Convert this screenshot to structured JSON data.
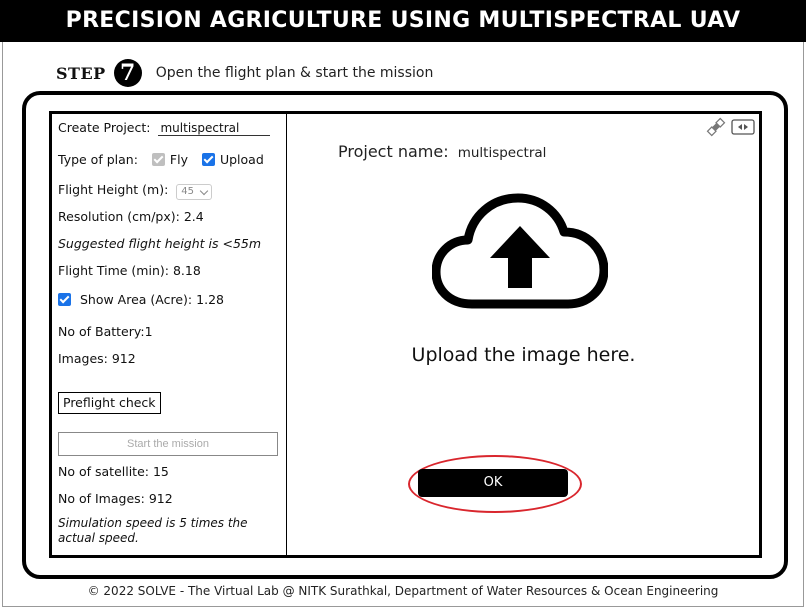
{
  "header": {
    "title": "PRECISION AGRICULTURE USING MULTISPECTRAL UAV"
  },
  "step": {
    "word": "STEP",
    "number": "7",
    "text": "Open the flight plan & start the mission"
  },
  "left": {
    "create_project_label": "Create Project:",
    "create_project_value": "multispectral",
    "type_of_plan_label": "Type of plan:",
    "fly_label": "Fly",
    "fly_checked": true,
    "fly_disabled": true,
    "upload_label": "Upload",
    "upload_checked": true,
    "flight_height_label": "Flight Height (m):",
    "flight_height_value": "45",
    "resolution_label": "Resolution (cm/px):",
    "resolution_value": "2.4",
    "suggested_text": "Suggested flight height is <55m",
    "flight_time_label": "Flight Time (min):",
    "flight_time_value": "8.18",
    "show_area_label": "Show Area (Acre):",
    "show_area_value": "1.28",
    "show_area_checked": true,
    "battery_label": "No of Battery:",
    "battery_value": "1",
    "images_label": "Images:",
    "images_value": "912",
    "preflight_button": "Preflight check",
    "start_mission_button": "Start the mission",
    "satellite_label": "No of satellite:",
    "satellite_value": "15",
    "no_images_label": "No of Images:",
    "no_images_value": "912",
    "simulation_text_line1": "Simulation speed is 5 times the",
    "simulation_text_line2": "actual speed."
  },
  "right": {
    "project_name_label": "Project name:",
    "project_name_value": "multispectral",
    "upload_text": "Upload the image here.",
    "ok_button": "OK",
    "icons": [
      "satellite-icon",
      "switch-panel-icon",
      "cloud-upload-icon"
    ]
  },
  "colors": {
    "checkbox_blue": "#1a73e8",
    "highlight_red": "#d9262d",
    "header_bg": "#000000"
  },
  "footer": {
    "text": "© 2022 SOLVE - The Virtual Lab @ NITK Surathkal, Department of Water Resources & Ocean Engineering"
  }
}
